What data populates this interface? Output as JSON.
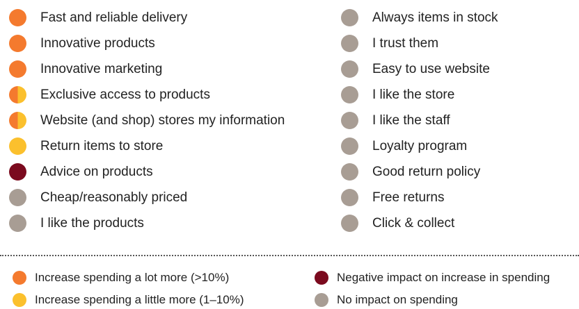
{
  "colors": {
    "increase_lot": "#F47A2E",
    "increase_little": "#FBC02D",
    "negative": "#7B0A1E",
    "no_impact": "#A89D94"
  },
  "left_items": [
    {
      "label": "Fast and reliable delivery",
      "impact": "increase_lot"
    },
    {
      "label": "Innovative products",
      "impact": "increase_lot"
    },
    {
      "label": "Innovative marketing",
      "impact": "increase_lot"
    },
    {
      "label": "Exclusive access to products",
      "impact": "split"
    },
    {
      "label": "Website (and shop) stores my information",
      "impact": "split"
    },
    {
      "label": "Return items to store",
      "impact": "increase_little"
    },
    {
      "label": "Advice on products",
      "impact": "negative"
    },
    {
      "label": "Cheap/reasonably priced",
      "impact": "no_impact"
    },
    {
      "label": "I like the products",
      "impact": "no_impact"
    }
  ],
  "right_items": [
    {
      "label": "Always items in stock",
      "impact": "no_impact"
    },
    {
      "label": "I trust them",
      "impact": "no_impact"
    },
    {
      "label": "Easy to use website",
      "impact": "no_impact"
    },
    {
      "label": "I like the store",
      "impact": "no_impact"
    },
    {
      "label": "I like the staff",
      "impact": "no_impact"
    },
    {
      "label": "Loyalty program",
      "impact": "no_impact"
    },
    {
      "label": "Good return policy",
      "impact": "no_impact"
    },
    {
      "label": "Free returns",
      "impact": "no_impact"
    },
    {
      "label": "Click & collect",
      "impact": "no_impact"
    }
  ],
  "legend": {
    "increase_lot": "Increase spending a lot more (>10%)",
    "increase_little": "Increase spending a little more (1–10%)",
    "negative": "Negative impact on increase in spending",
    "no_impact": "No impact on spending"
  }
}
